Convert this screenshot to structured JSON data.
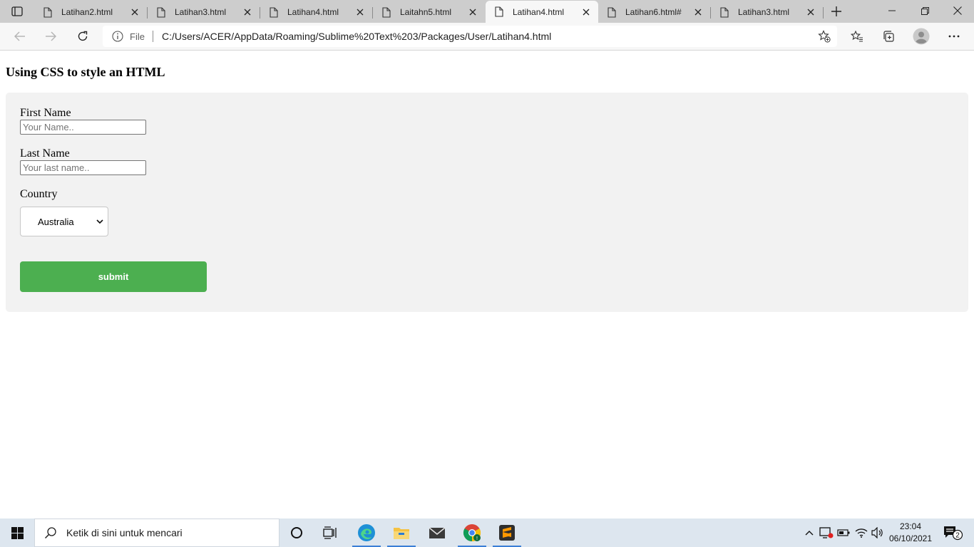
{
  "browser": {
    "tabs": [
      {
        "title": "Latihan2.html",
        "active": false
      },
      {
        "title": "Latihan3.html",
        "active": false
      },
      {
        "title": "Latihan4.html",
        "active": false
      },
      {
        "title": "Laitahn5.html",
        "active": false
      },
      {
        "title": "Latihan4.html",
        "active": true
      },
      {
        "title": "Latihan6.html#",
        "active": false
      },
      {
        "title": "Latihan3.html",
        "active": false
      }
    ],
    "address": {
      "scheme_label": "File",
      "url": "C:/Users/ACER/AppData/Roaming/Sublime%20Text%203/Packages/User/Latihan4.html"
    }
  },
  "page": {
    "heading": "Using CSS to style an HTML",
    "form": {
      "first_name": {
        "label": "First Name",
        "placeholder": "Your Name.."
      },
      "last_name": {
        "label": "Last Name",
        "placeholder": "Your last name.."
      },
      "country": {
        "label": "Country",
        "selected": "Australia"
      },
      "submit_label": "submit"
    }
  },
  "taskbar": {
    "search_placeholder": "Ketik di sini untuk mencari",
    "clock_time": "23:04",
    "clock_date": "06/10/2021",
    "notification_count": "2"
  },
  "colors": {
    "submit_bg": "#4caf50",
    "panel_bg": "#f2f2f2",
    "tabstrip_bg": "#cdcdcd"
  }
}
